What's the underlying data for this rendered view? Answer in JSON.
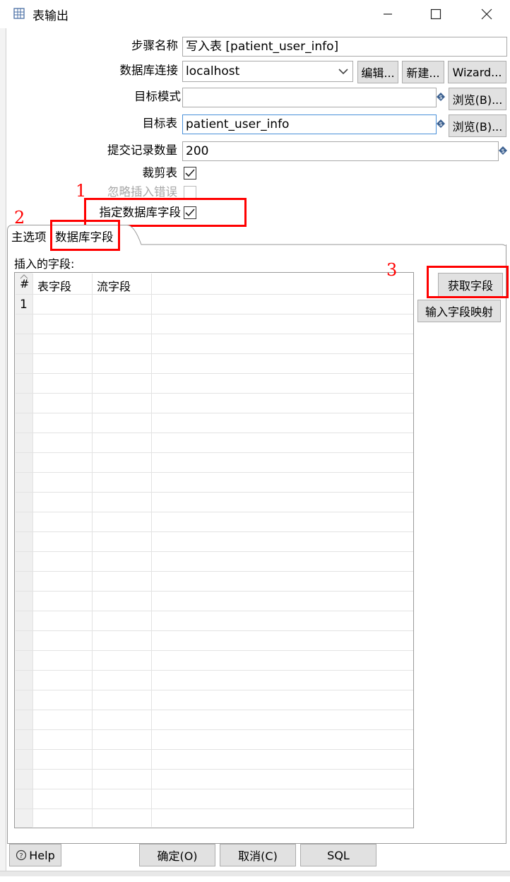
{
  "window": {
    "title": "表输出",
    "minimize_icon": "minimize-icon",
    "maximize_icon": "maximize-icon",
    "close_icon": "close-icon"
  },
  "form": {
    "step_name_label": "步骤名称",
    "step_name_value": "写入表 [patient_user_info]",
    "db_conn_label": "数据库连接",
    "db_conn_value": "localhost",
    "edit_button": "编辑...",
    "new_button": "新建...",
    "wizard_button": "Wizard...",
    "target_schema_label": "目标模式",
    "target_schema_value": "",
    "browse_button": "浏览(B)...",
    "target_table_label": "目标表",
    "target_table_value": "patient_user_info",
    "commit_size_label": "提交记录数量",
    "commit_size_value": "200",
    "truncate_label": "裁剪表",
    "ignore_errors_label": "忽略插入错误",
    "specify_fields_label": "指定数据库字段"
  },
  "annotations": {
    "n1": "1",
    "n2": "2",
    "n3": "3"
  },
  "tabs": {
    "main": "主选项",
    "db_fields": "数据库字段"
  },
  "fields_panel": {
    "label": "插入的字段:",
    "col_index": "#",
    "col_table_field": "表字段",
    "col_stream_field": "流字段",
    "row1_index": "1",
    "get_fields_button": "获取字段",
    "mapping_button": "输入字段映射"
  },
  "footer": {
    "help_button": "Help",
    "ok_button": "确定(O)",
    "cancel_button": "取消(C)",
    "sql_button": "SQL"
  }
}
